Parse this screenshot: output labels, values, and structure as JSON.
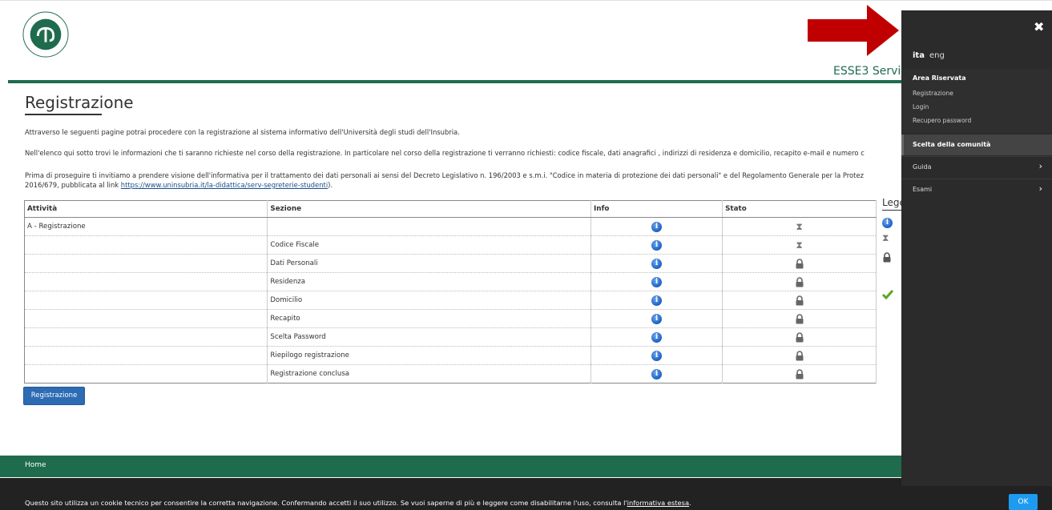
{
  "header": {
    "app_title": "ESSE3 Servi"
  },
  "page": {
    "title": "Registrazione",
    "para1": "Attraverso le seguenti pagine potrai procedere con la registrazione al sistema informativo dell'Università degli studi dell'Insubria.",
    "para2": "Nell'elenco qui sotto trovi le informazioni che ti saranno richieste nel corso della registrazione. In particolare nel corso della registrazione ti verranno richiesti: codice fiscale, dati anagrafici , indirizzi di residenza e domicilio, recapito e-mail e numero c",
    "para3_line1": "Prima di proseguire ti invitiamo a prendere visione dell'informativa per il trattamento dei dati personali ai sensi del Decreto Legislativo n. 196/2003 e s.m.i. \"Codice in materia di protezione dei dati personali\" e del Regolamento Generale per la Protez",
    "para3_line2_prefix": "2016/679, pubblicata al link ",
    "para3_link": "https://www.uninsubria.it/la-didattica/serv-segreterie-studenti",
    "para3_suffix": ")."
  },
  "table": {
    "headers": [
      "Attività",
      "Sezione",
      "Info",
      "Stato"
    ],
    "rows": [
      {
        "attivita": "A - Registrazione",
        "sezione": "",
        "stato": "hourglass-icon"
      },
      {
        "attivita": "",
        "sezione": "Codice Fiscale",
        "stato": "hourglass-icon"
      },
      {
        "attivita": "",
        "sezione": "Dati Personali",
        "stato": "lock-icon"
      },
      {
        "attivita": "",
        "sezione": "Residenza",
        "stato": "lock-icon"
      },
      {
        "attivita": "",
        "sezione": "Domicilio",
        "stato": "lock-icon"
      },
      {
        "attivita": "",
        "sezione": "Recapito",
        "stato": "lock-icon"
      },
      {
        "attivita": "",
        "sezione": "Scelta Password",
        "stato": "lock-icon"
      },
      {
        "attivita": "",
        "sezione": "Riepilogo registrazione",
        "stato": "lock-icon"
      },
      {
        "attivita": "",
        "sezione": "Registrazione conclusa",
        "stato": "lock-icon"
      }
    ]
  },
  "legend": {
    "title": "Lege"
  },
  "actions": {
    "registrazione_button": "Registrazione"
  },
  "footer": {
    "home": "Home"
  },
  "cookie": {
    "text": "Questo sito utilizza un cookie tecnico per consentire la corretta navigazione. Confermando accetti il suo utilizzo. Se vuoi saperne di più e leggere come disabilitarne l'uso, consulta l'",
    "link": "informativa estesa",
    "suffix": ".",
    "ok": "OK"
  },
  "sidebar": {
    "lang_active": "ita",
    "lang_other": "eng",
    "area_title": "Area Riservata",
    "area_links": [
      "Registrazione",
      "Login",
      "Recupero password"
    ],
    "scelta": "Scelta della comunità",
    "menu": [
      "Guida",
      "Esami"
    ]
  },
  "colors": {
    "brand_green": "#1f6b4e",
    "button_blue": "#2d6bb3",
    "arrow_red": "#c00000"
  }
}
